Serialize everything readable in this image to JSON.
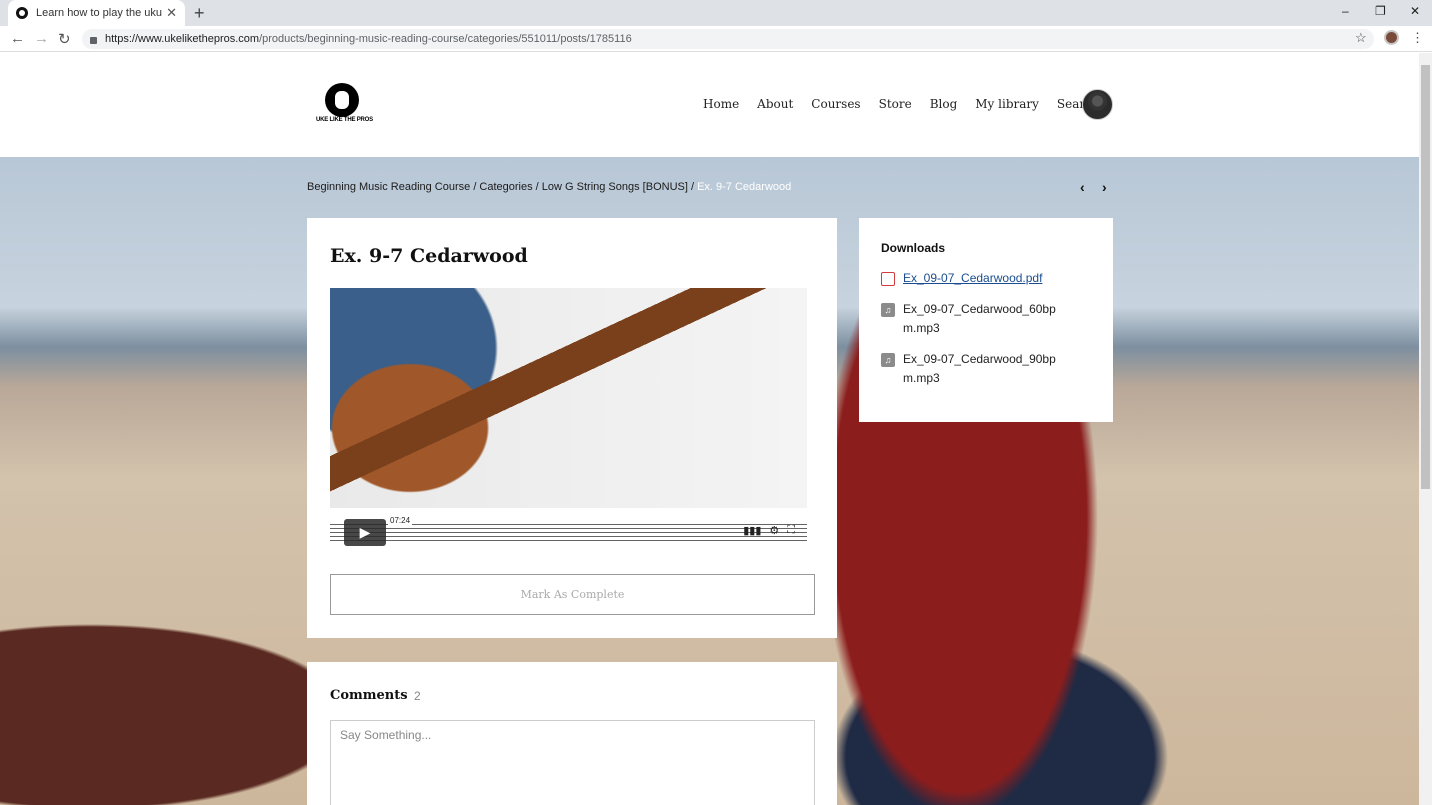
{
  "browser": {
    "tab_title": "Learn how to play the ukulele wi",
    "tab_close": "✕",
    "new_tab": "+",
    "url_host": "https://www.ukelikethepros.com",
    "url_path": "/products/beginning-music-reading-course/categories/551011/posts/1785116",
    "window_controls": [
      "–",
      "❐",
      "✕"
    ]
  },
  "site": {
    "logo_text": "UKE LIKE THE PROS",
    "nav": [
      "Home",
      "About",
      "Courses",
      "Store",
      "Blog",
      "My library",
      "Search"
    ]
  },
  "breadcrumb": {
    "path": "Beginning Music Reading Course / Categories / Low G String Songs [BONUS] / ",
    "current": "Ex. 9-7 Cedarwood"
  },
  "lesson": {
    "title": "Ex. 9-7 Cedarwood",
    "video_time": "07:24",
    "mark_complete_label": "Mark As Complete"
  },
  "downloads": {
    "heading": "Downloads",
    "items": [
      {
        "name": "Ex_09-07_Cedarwood.pdf",
        "icon": "pdf-icon"
      },
      {
        "name": "Ex_09-07_Cedarwood_60bpm.mp3",
        "icon": "audio-icon"
      },
      {
        "name": "Ex_09-07_Cedarwood_90bpm.mp3",
        "icon": "audio-icon"
      }
    ]
  },
  "comments": {
    "title": "Comments",
    "count": "2",
    "placeholder": "Say Something..."
  }
}
